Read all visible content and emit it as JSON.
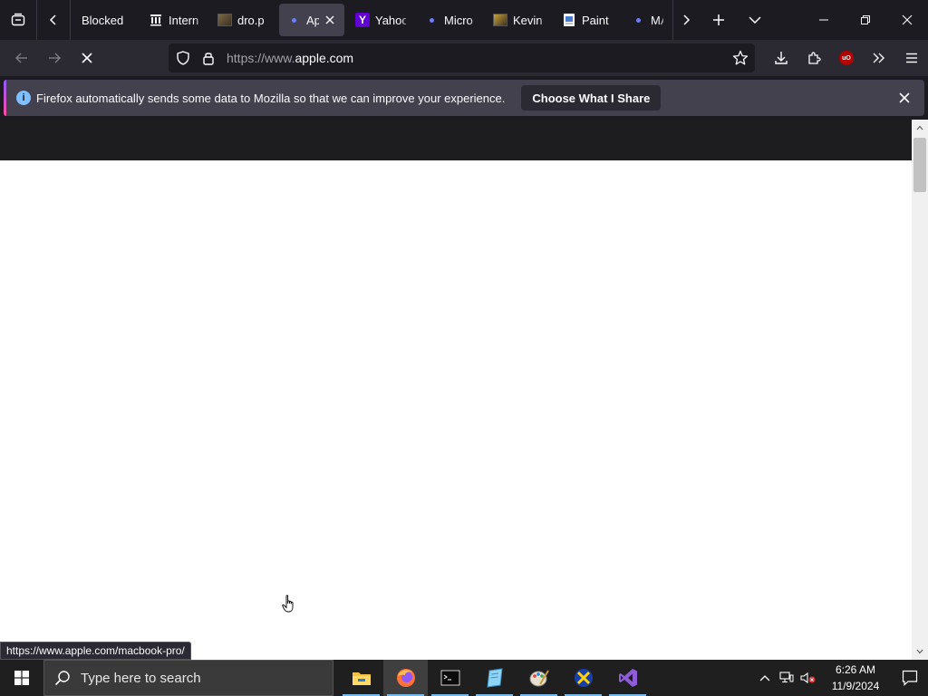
{
  "tabs": [
    {
      "label": "Blocked",
      "icon": "none",
      "selected": false
    },
    {
      "label": "Intern",
      "icon": "archive-columns-icon",
      "selected": false
    },
    {
      "label": "dro.p",
      "icon": "image-thumbnail-icon",
      "selected": false
    },
    {
      "label": "Ap",
      "icon": "loading-dot-icon",
      "selected": true
    },
    {
      "label": "Yahoo",
      "icon": "yahoo-icon",
      "selected": false
    },
    {
      "label": "Micro",
      "icon": "loading-dot-icon",
      "selected": false
    },
    {
      "label": "Kevin",
      "icon": "image-thumbnail-icon",
      "selected": false
    },
    {
      "label": "Paint",
      "icon": "document-icon",
      "selected": false
    },
    {
      "label": "MA",
      "icon": "loading-dot-icon",
      "selected": false
    }
  ],
  "yahoo_letter": "Y",
  "urlbar": {
    "prefix": "https://www.",
    "domain": "apple.com"
  },
  "ublock_badge": "uO",
  "notification": {
    "info_glyph": "i",
    "message": "Firefox automatically sends some data to Mozilla so that we can improve your experience.",
    "button": "Choose What I Share"
  },
  "status_url": "https://www.apple.com/macbook-pro/",
  "taskbar": {
    "search_placeholder": "Type here to search",
    "apps": [
      "file-explorer-icon",
      "firefox-icon",
      "terminal-icon",
      "notepad-icon",
      "paint-icon",
      "xming-icon",
      "visual-studio-icon"
    ]
  },
  "clock": {
    "time": "6:26 AM",
    "date": "11/9/2024"
  },
  "colors": {
    "accent": "#76b9ed",
    "chrome": "#1c1b22",
    "toolbar": "#2b2a33",
    "apple_nav": "#1d1d1f"
  }
}
